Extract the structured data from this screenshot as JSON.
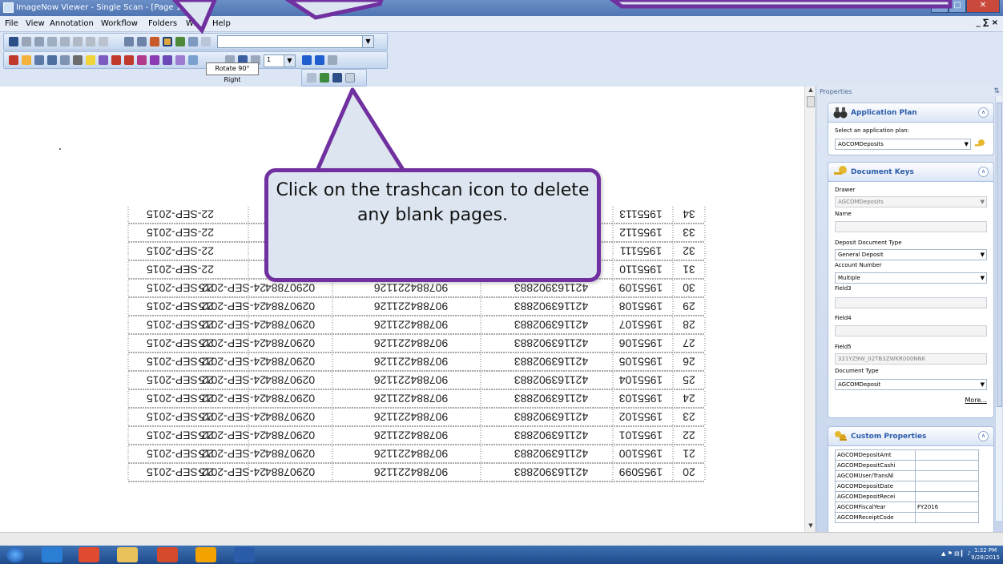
{
  "window": {
    "title": "ImageNow Viewer - Single Scan - [Page 1]"
  },
  "menu": {
    "items": [
      "File",
      "View",
      "Annotation",
      "Workflow",
      "Folders",
      "Wi",
      "Help"
    ]
  },
  "toolbar": {
    "tooltip": "Rotate 90° Right",
    "page_number": "1"
  },
  "callout": {
    "text": "Click on the trashcan icon to delete any blank pages."
  },
  "document": {
    "rows": [
      {
        "n": "34",
        "id": "1955113",
        "a": "",
        "b": "",
        "c": "",
        "d": "",
        "date": "22-SEP-2015"
      },
      {
        "n": "33",
        "id": "1955112",
        "a": "",
        "b": "",
        "c": "",
        "d": "",
        "date": "22-SEP-2015"
      },
      {
        "n": "32",
        "id": "1955111",
        "a": "",
        "b": "",
        "c": "",
        "d": "",
        "date": "22-SEP-2015"
      },
      {
        "n": "31",
        "id": "1955110",
        "a": "",
        "b": "",
        "c": "",
        "d": "",
        "date": "22-SEP-2015"
      },
      {
        "n": "30",
        "id": "1955109",
        "a": "421163902883",
        "b": "907884221126",
        "c": "02907884",
        "d": "24-SEP-2015",
        "date": "22-SEP-2015"
      },
      {
        "n": "29",
        "id": "1955108",
        "a": "421163902883",
        "b": "907884221126",
        "c": "02907884",
        "d": "24-SEP-2015",
        "date": "22-SEP-2015"
      },
      {
        "n": "28",
        "id": "1955107",
        "a": "421163902883",
        "b": "907884221126",
        "c": "02907884",
        "d": "24-SEP-2015",
        "date": "22-SEP-2015"
      },
      {
        "n": "27",
        "id": "1955106",
        "a": "421163902883",
        "b": "907884221126",
        "c": "02907884",
        "d": "24-SEP-2015",
        "date": "22-SEP-2015"
      },
      {
        "n": "26",
        "id": "1955105",
        "a": "421163902883",
        "b": "907884221126",
        "c": "02907884",
        "d": "24-SEP-2015",
        "date": "22-SEP-2015"
      },
      {
        "n": "25",
        "id": "1955104",
        "a": "421163902883",
        "b": "907884221126",
        "c": "02907884",
        "d": "24-SEP-2015",
        "date": "22-SEP-2015"
      },
      {
        "n": "24",
        "id": "1955103",
        "a": "421163902883",
        "b": "907884221126",
        "c": "02907884",
        "d": "24-SEP-2015",
        "date": "22-SEP-2015"
      },
      {
        "n": "23",
        "id": "1955102",
        "a": "421163902883",
        "b": "907884221126",
        "c": "02907884",
        "d": "24-SEP-2015",
        "date": "22-SEP-2015"
      },
      {
        "n": "22",
        "id": "1955101",
        "a": "421163902883",
        "b": "907884221126",
        "c": "02907884",
        "d": "24-SEP-2015",
        "date": "22-SEP-2015"
      },
      {
        "n": "21",
        "id": "1955100",
        "a": "421163902883",
        "b": "907884221126",
        "c": "02907884",
        "d": "24-SEP-2015",
        "date": "22-SEP-2015"
      },
      {
        "n": "20",
        "id": "1955099",
        "a": "421163902883",
        "b": "907884221126",
        "c": "02907884",
        "d": "24-SEP-2015",
        "date": "22-SEP-2015"
      }
    ]
  },
  "properties": {
    "header": "Properties",
    "application_plan": {
      "title": "Application Plan",
      "prompt": "Select an application plan:",
      "value": "AGCOMDeposits"
    },
    "document_keys": {
      "title": "Document Keys",
      "drawer_label": "Drawer",
      "drawer_value": "AGCOMDeposits",
      "name_label": "Name",
      "name_value": "",
      "deposit_type_label": "Deposit Document Type",
      "deposit_type_value": "General Deposit",
      "account_label": "Account Number",
      "account_value": "Multiple",
      "field3_label": "Field3",
      "field4_label": "Field4",
      "field5_label": "Field5",
      "field5_value": "321YZ9W_02TB3ZWKR000NNK",
      "doctype_label": "Document Type",
      "doctype_value": "AGCOMDeposit",
      "more": "More..."
    },
    "custom_properties": {
      "title": "Custom Properties",
      "rows": [
        {
          "name": "AGCOMDepositAmt",
          "value": ""
        },
        {
          "name": "AGCOMDepositCashi",
          "value": ""
        },
        {
          "name": "AGCOMUser/TransNl",
          "value": ""
        },
        {
          "name": "AGCOMDepositDate",
          "value": ""
        },
        {
          "name": "AGCOMDepositRecei",
          "value": ""
        },
        {
          "name": "AGCOMFiscalYear",
          "value": "FY2016"
        },
        {
          "name": "AGCOMReceiptCode",
          "value": ""
        }
      ]
    }
  },
  "taskbar": {
    "time": "1:32 PM",
    "date": "9/28/2015"
  },
  "colors": {
    "callout_border": "#7030a0",
    "title_bar": "#5a7fbd"
  }
}
